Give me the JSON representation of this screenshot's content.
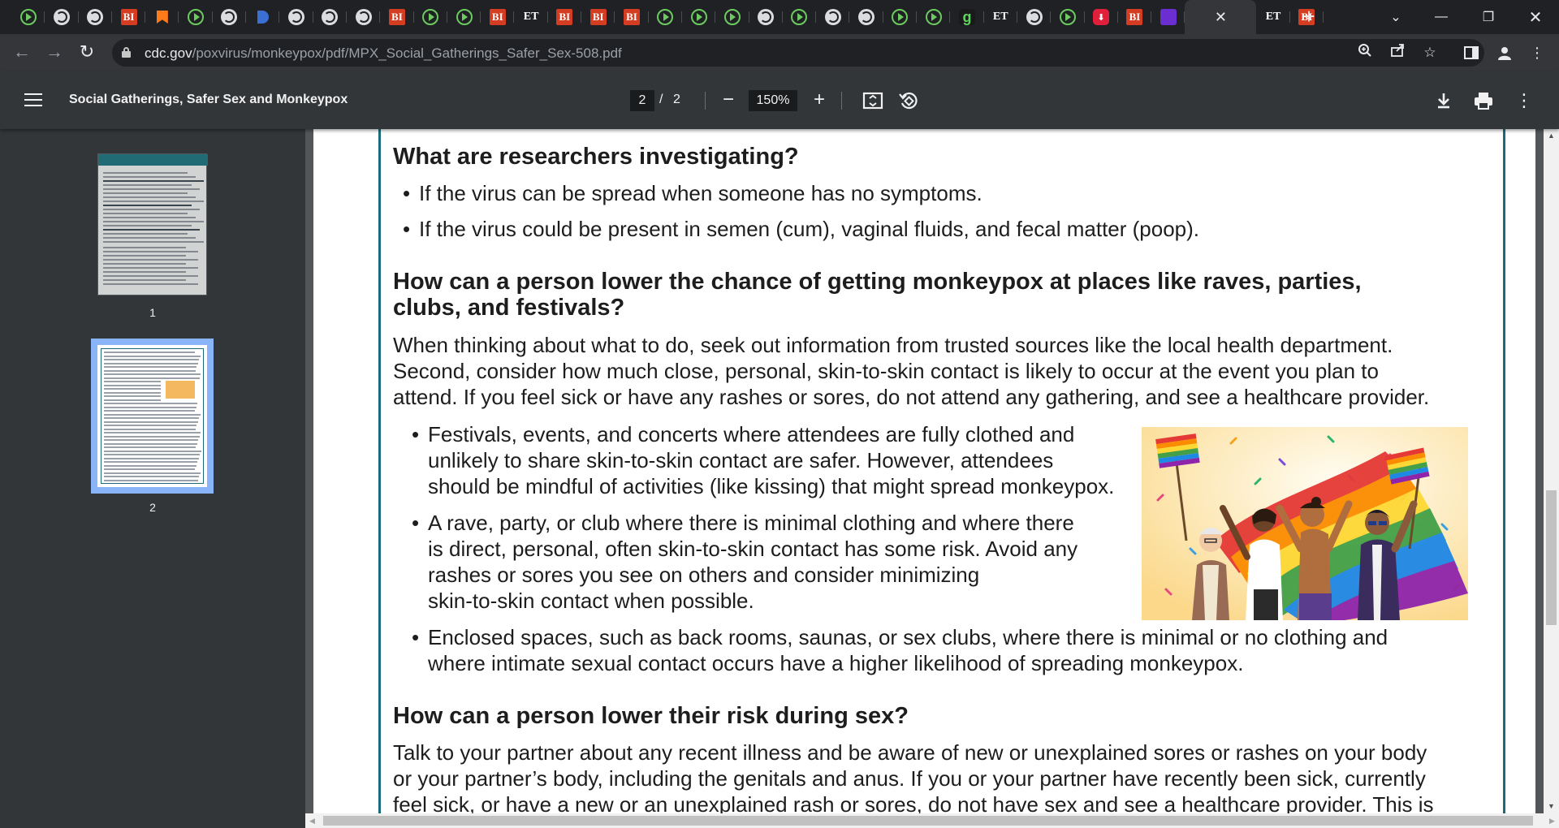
{
  "browser": {
    "tab_favicons": [
      "play-icon",
      "globe-icon",
      "globe-icon",
      "bi-icon",
      "bookmark-icon",
      "play-icon",
      "globe-icon",
      "halfmoon-icon",
      "globe-icon",
      "globe-icon",
      "globe-icon",
      "bi-icon",
      "play-icon",
      "play-icon",
      "bi-icon",
      "et-icon",
      "bi-icon",
      "bi-icon",
      "bi-icon",
      "play-icon",
      "play-icon",
      "play-icon",
      "globe-icon",
      "play-icon",
      "globe-icon",
      "globe-icon",
      "play-icon",
      "play-icon",
      "g-icon",
      "et-icon",
      "globe-icon",
      "play-icon",
      "shield-icon",
      "bi-icon",
      "purple-icon"
    ],
    "active_tab_close": "✕",
    "after_tabs": [
      "et-icon",
      "bi-icon"
    ],
    "new_tab_label": "+",
    "bi_text": "BI",
    "et_text": "ET",
    "g_text": "g",
    "url_host": "cdc.gov",
    "url_path": "/poxvirus/monkeypox/pdf/MPX_Social_Gatherings_Safer_Sex-508.pdf"
  },
  "viewer": {
    "title": "Social Gatherings, Safer Sex and Monkeypox",
    "page_current": "2",
    "page_sep": "/",
    "page_total": "2",
    "zoom": "150%",
    "thumb_labels": [
      "1",
      "2"
    ]
  },
  "document": {
    "h_researchers": "What are researchers investigating?",
    "researchers_bullets": [
      "If the virus can be spread when someone has no symptoms.",
      "If the virus could be present in semen (cum), vaginal fluids, and fecal matter (poop)."
    ],
    "h_events_line1": "How can a person lower the chance of getting monkeypox at places like raves, parties,",
    "h_events_line2": "clubs, and festivals?",
    "events_para": [
      "When thinking about what to do, seek out information from trusted sources like the local health department.",
      "Second, consider how much close, personal, skin-to-skin contact is likely to occur at the event you plan to",
      "attend. If you feel sick or have any rashes or sores, do not attend any gathering, and see a healthcare provider."
    ],
    "events_bullet1": [
      "Festivals, events, and concerts where attendees are fully clothed and",
      "unlikely to share skin-to-skin contact are safer. However, attendees",
      "should be mindful of activities (like kissing) that might spread monkeypox."
    ],
    "events_bullet2": [
      "A rave, party, or club where there is minimal clothing and where there",
      "is direct, personal, often skin-to-skin contact has some risk. Avoid any",
      "rashes or sores you see on others and consider minimizing",
      "skin-to-skin contact when possible."
    ],
    "events_bullet3": [
      "Enclosed spaces, such as back rooms, saunas, or sex clubs, where there is minimal or no clothing and",
      "where intimate sexual contact occurs have a higher likelihood of spreading monkeypox."
    ],
    "h_sex": "How can a person lower their risk during sex?",
    "sex_para": [
      "Talk to your partner about any recent illness and be aware of new or unexplained sores or rashes on your body",
      "or your partner’s body, including the genitals and anus. If you or your partner have recently been sick, currently",
      "feel sick, or have a new or an unexplained rash or sores, do not have sex and see a healthcare provider. This is"
    ]
  },
  "colors": {
    "page_rule": "#1c6b78",
    "viewer_toolbar": "#323639",
    "viewer_bg": "#525659"
  }
}
